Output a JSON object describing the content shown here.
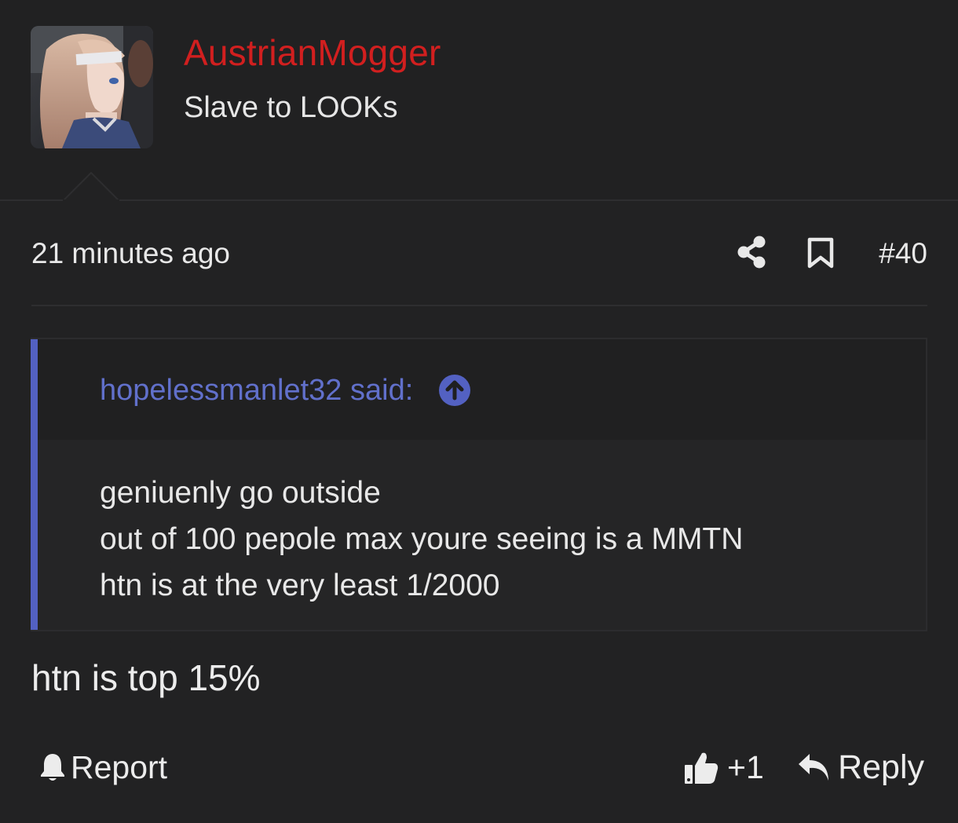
{
  "header": {
    "avatar_alt": "Anime-style avatar",
    "username": "AustrianMogger",
    "user_title": "Slave to LOOKs"
  },
  "meta": {
    "timestamp": "21 minutes ago",
    "post_number": "#40",
    "icons": [
      "share-icon",
      "bookmark-icon"
    ]
  },
  "quote": {
    "author_line": "hopelessmanlet32 said:",
    "jump_icon": "arrow-up-circle-icon",
    "lines": [
      "geniuenly go outside",
      "out of 100 pepole max youre seeing is a MMTN",
      "htn is at the very least 1/2000"
    ]
  },
  "message": {
    "text": "htn is top 15%"
  },
  "footer": {
    "report_label": "Report",
    "like_count": "+1",
    "reply_label": "Reply"
  },
  "colors": {
    "background": "#222223",
    "username": "#d11f1f",
    "quote_accent": "#5361c2",
    "quote_author": "#6170cb",
    "text": "#e8e8e8"
  }
}
